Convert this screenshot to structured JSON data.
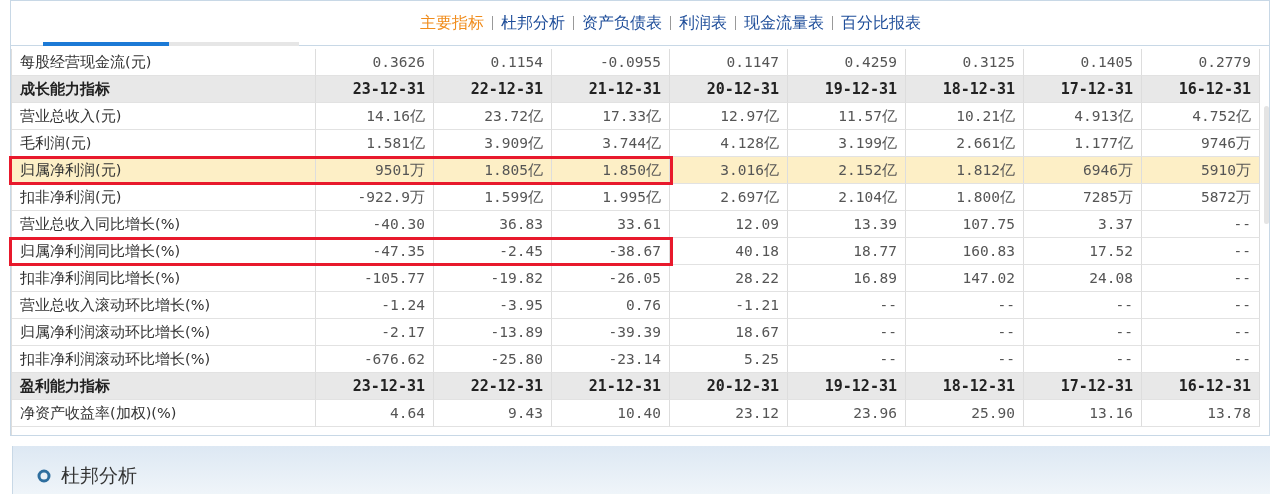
{
  "tabs": [
    {
      "label": "主要指标",
      "selected": true
    },
    {
      "label": "杜邦分析",
      "selected": false
    },
    {
      "label": "资产负债表",
      "selected": false
    },
    {
      "label": "利润表",
      "selected": false
    },
    {
      "label": "现金流量表",
      "selected": false
    },
    {
      "label": "百分比报表",
      "selected": false
    }
  ],
  "table": {
    "rows": [
      {
        "kind": "data",
        "label": "每股经营现金流(元)",
        "highlighted": false,
        "boxed": false,
        "values": [
          "0.3626",
          "0.1154",
          "-0.0955",
          "0.1147",
          "0.4259",
          "0.3125",
          "0.1405",
          "0.2779"
        ]
      },
      {
        "kind": "header",
        "label": "成长能力指标",
        "highlighted": false,
        "boxed": false,
        "values": [
          "23-12-31",
          "22-12-31",
          "21-12-31",
          "20-12-31",
          "19-12-31",
          "18-12-31",
          "17-12-31",
          "16-12-31"
        ]
      },
      {
        "kind": "data",
        "label": "营业总收入(元)",
        "highlighted": false,
        "boxed": false,
        "values": [
          "14.16亿",
          "23.72亿",
          "17.33亿",
          "12.97亿",
          "11.57亿",
          "10.21亿",
          "4.913亿",
          "4.752亿"
        ]
      },
      {
        "kind": "data",
        "label": "毛利润(元)",
        "highlighted": false,
        "boxed": false,
        "values": [
          "1.581亿",
          "3.909亿",
          "3.744亿",
          "4.128亿",
          "3.199亿",
          "2.661亿",
          "1.177亿",
          "9746万"
        ]
      },
      {
        "kind": "data",
        "label": "归属净利润(元)",
        "highlighted": true,
        "boxed": true,
        "values": [
          "9501万",
          "1.805亿",
          "1.850亿",
          "3.016亿",
          "2.152亿",
          "1.812亿",
          "6946万",
          "5910万"
        ]
      },
      {
        "kind": "data",
        "label": "扣非净利润(元)",
        "highlighted": false,
        "boxed": false,
        "values": [
          "-922.9万",
          "1.599亿",
          "1.995亿",
          "2.697亿",
          "2.104亿",
          "1.800亿",
          "7285万",
          "5872万"
        ]
      },
      {
        "kind": "data",
        "label": "营业总收入同比增长(%)",
        "highlighted": false,
        "boxed": false,
        "values": [
          "-40.30",
          "36.83",
          "33.61",
          "12.09",
          "13.39",
          "107.75",
          "3.37",
          "--"
        ]
      },
      {
        "kind": "data",
        "label": "归属净利润同比增长(%)",
        "highlighted": false,
        "boxed": true,
        "values": [
          "-47.35",
          "-2.45",
          "-38.67",
          "40.18",
          "18.77",
          "160.83",
          "17.52",
          "--"
        ]
      },
      {
        "kind": "data",
        "label": "扣非净利润同比增长(%)",
        "highlighted": false,
        "boxed": false,
        "values": [
          "-105.77",
          "-19.82",
          "-26.05",
          "28.22",
          "16.89",
          "147.02",
          "24.08",
          "--"
        ]
      },
      {
        "kind": "data",
        "label": "营业总收入滚动环比增长(%)",
        "highlighted": false,
        "boxed": false,
        "values": [
          "-1.24",
          "-3.95",
          "0.76",
          "-1.21",
          "--",
          "--",
          "--",
          "--"
        ]
      },
      {
        "kind": "data",
        "label": "归属净利润滚动环比增长(%)",
        "highlighted": false,
        "boxed": false,
        "values": [
          "-2.17",
          "-13.89",
          "-39.39",
          "18.67",
          "--",
          "--",
          "--",
          "--"
        ]
      },
      {
        "kind": "data",
        "label": "扣非净利润滚动环比增长(%)",
        "highlighted": false,
        "boxed": false,
        "values": [
          "-676.62",
          "-25.80",
          "-23.14",
          "5.25",
          "--",
          "--",
          "--",
          "--"
        ]
      },
      {
        "kind": "header",
        "label": "盈利能力指标",
        "highlighted": false,
        "boxed": false,
        "values": [
          "23-12-31",
          "22-12-31",
          "21-12-31",
          "20-12-31",
          "19-12-31",
          "18-12-31",
          "17-12-31",
          "16-12-31"
        ]
      },
      {
        "kind": "data",
        "label": "净资产收益率(加权)(%)",
        "highlighted": false,
        "boxed": false,
        "values": [
          "4.64",
          "9.43",
          "10.40",
          "23.12",
          "23.96",
          "25.90",
          "13.16",
          "13.78"
        ]
      }
    ]
  },
  "section": {
    "title": "杜邦分析"
  }
}
